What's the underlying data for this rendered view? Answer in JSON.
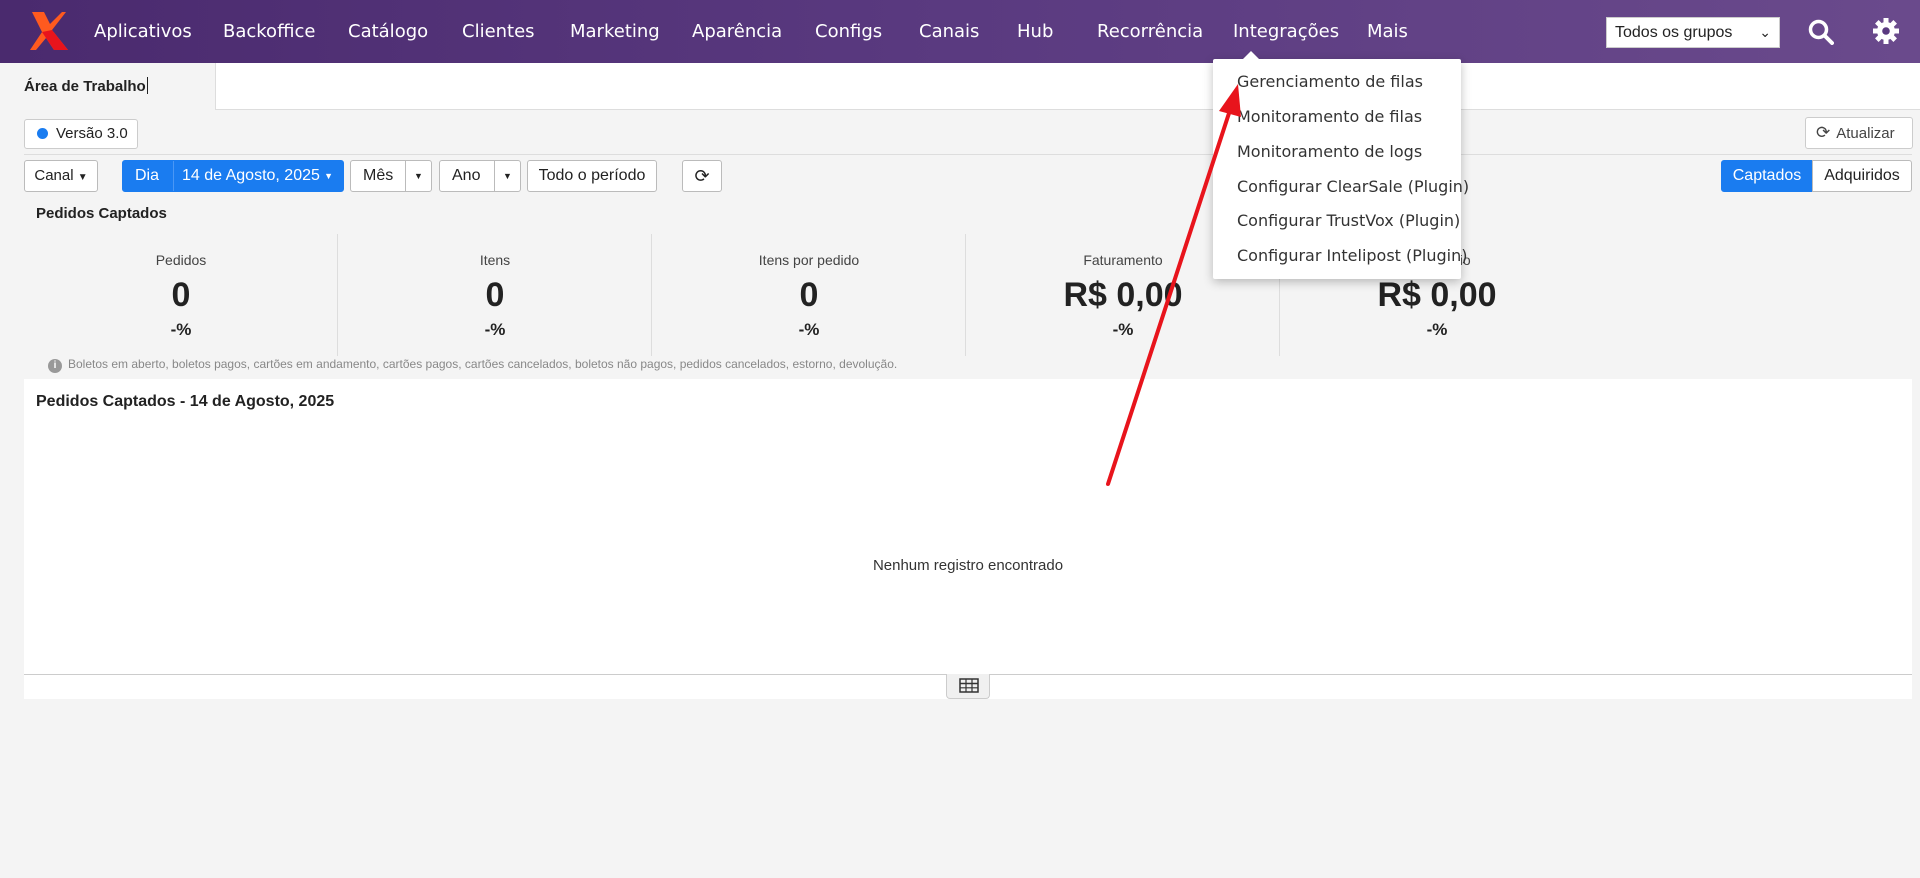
{
  "nav": {
    "items": [
      "Aplicativos",
      "Backoffice",
      "Catálogo",
      "Clientes",
      "Marketing",
      "Aparência",
      "Configs",
      "Canais",
      "Hub",
      "Recorrência",
      "Integrações",
      "Mais"
    ],
    "group_select": "Todos os grupos"
  },
  "tabs": {
    "active": "Área de Trabalho"
  },
  "version": "Versão 3.0",
  "update_label": "Atualizar",
  "controls": {
    "canal": "Canal",
    "dia": "Dia",
    "date": "14 de Agosto, 2025",
    "mes": "Mês",
    "ano": "Ano",
    "todo": "Todo o período",
    "captados": "Captados",
    "adquiridos": "Adquiridos"
  },
  "section_title": "Pedidos Captados",
  "stats": [
    {
      "label": "Pedidos",
      "value": "0",
      "pct": "-%"
    },
    {
      "label": "Itens",
      "value": "0",
      "pct": "-%"
    },
    {
      "label": "Itens por pedido",
      "value": "0",
      "pct": "-%"
    },
    {
      "label": "Faturamento",
      "value": "R$ 0,00",
      "pct": "-%"
    },
    {
      "label": "dio",
      "value": "R$ 0,00",
      "pct": "-%"
    }
  ],
  "note": "Boletos em aberto, boletos pagos, cartões em andamento, cartões pagos, cartões cancelados, boletos não pagos, pedidos cancelados, estorno, devolução.",
  "panel": {
    "title": "Pedidos Captados - 14 de Agosto, 2025",
    "empty": "Nenhum registro encontrado"
  },
  "dropdown": {
    "items": [
      "Gerenciamento de filas",
      "Monitoramento de filas",
      "Monitoramento de logs",
      "Configurar ClearSale (Plugin)",
      "Configurar TrustVox (Plugin)",
      "Configurar Intelipost (Plugin)"
    ]
  },
  "colors": {
    "nav": "#4a2a6e",
    "accent": "#1a7cf0",
    "arrow": "#e8141c"
  }
}
